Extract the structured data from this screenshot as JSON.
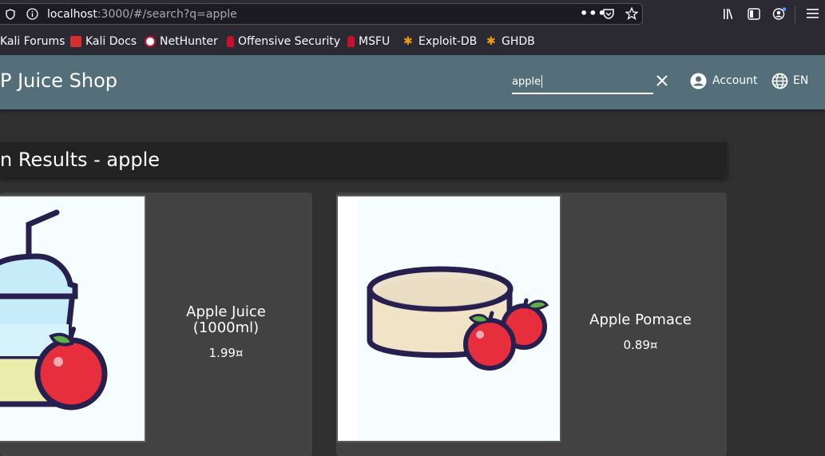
{
  "browser": {
    "url_host": "localhost",
    "url_rest": ":3000/#/search?q=apple",
    "bookmarks": [
      {
        "label": "Kali Forums"
      },
      {
        "label": "Kali Docs"
      },
      {
        "label": "NetHunter"
      },
      {
        "label": "Offensive Security"
      },
      {
        "label": "MSFU"
      },
      {
        "label": "Exploit-DB"
      },
      {
        "label": "GHDB"
      }
    ]
  },
  "header": {
    "title": "P Juice Shop",
    "search_value": "apple",
    "account_label": "Account",
    "language_label": "EN"
  },
  "results": {
    "title": "n Results - apple",
    "products": [
      {
        "name": "Apple Juice (1000ml)",
        "price": "1.99¤"
      },
      {
        "name": "Apple Pomace",
        "price": "0.89¤"
      }
    ]
  },
  "colors": {
    "header_bg": "#546e7a",
    "page_bg": "#303030",
    "card_bg": "#424242",
    "apple_red": "#e62e3d"
  }
}
